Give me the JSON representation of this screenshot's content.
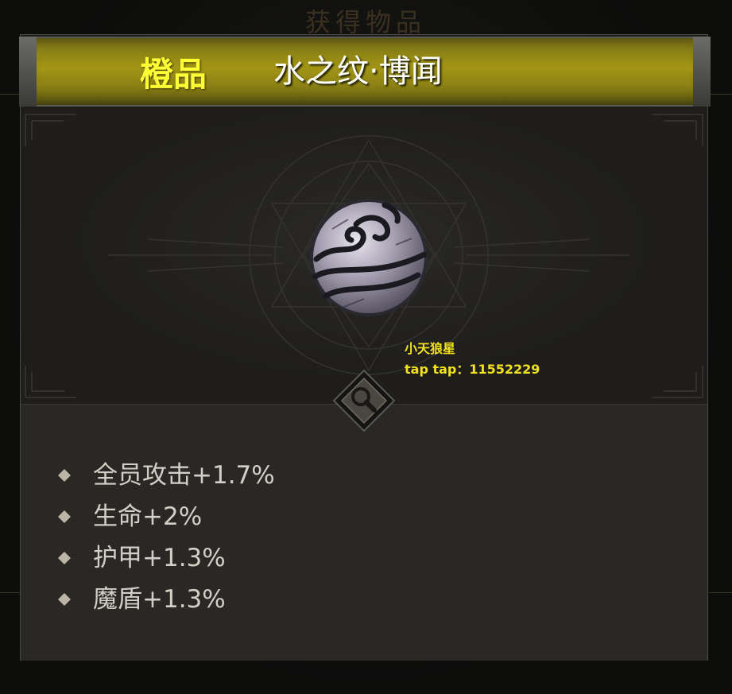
{
  "background": {
    "title_text": "获得物品"
  },
  "item": {
    "rarity": "橙品",
    "name": "水之纹·博闻",
    "icon": "water-wave-orb-icon"
  },
  "watermark": {
    "line1": "小天狼星",
    "line2": "tap tap：11552229"
  },
  "magnify_button": {
    "icon": "magnifier-icon"
  },
  "stats": [
    {
      "label": "全员攻击+1.7%"
    },
    {
      "label": "生命+2%"
    },
    {
      "label": "护甲+1.3%"
    },
    {
      "label": "魔盾+1.3%"
    }
  ],
  "colors": {
    "rarity_orange": "#ffff36",
    "banner_gold": "#a29515",
    "stat_text": "#d2cfc6",
    "watermark_yellow": "#f2e21d"
  }
}
